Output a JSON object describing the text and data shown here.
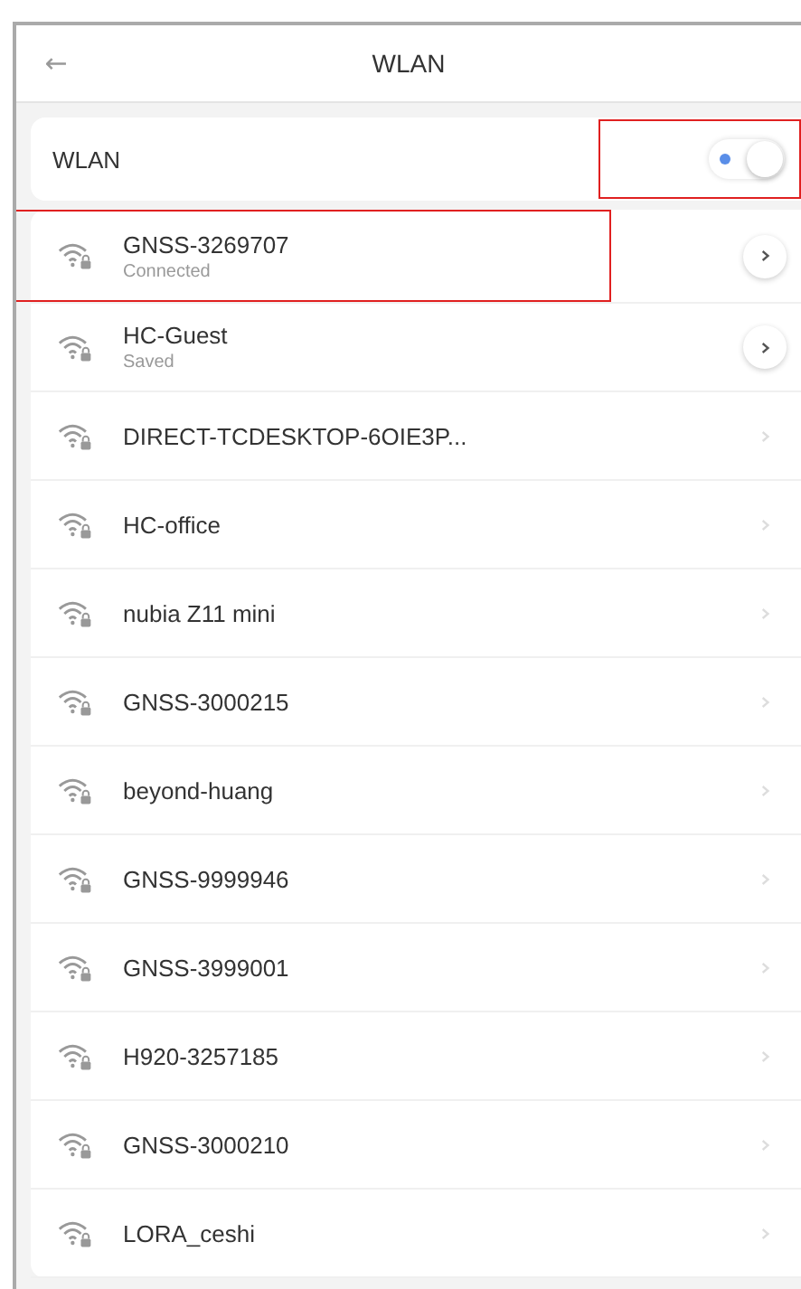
{
  "header": {
    "back": "←",
    "title": "WLAN"
  },
  "wlan_switch": {
    "label": "WLAN",
    "on": true,
    "highlighted": true
  },
  "networks": [
    {
      "name": "GNSS-3269707",
      "status": "Connected",
      "saved": true,
      "highlighted": true
    },
    {
      "name": "HC-Guest",
      "status": "Saved",
      "saved": true,
      "highlighted": false
    },
    {
      "name": "DIRECT-TCDESKTOP-6OIE3P...",
      "saved": false,
      "highlighted": false
    },
    {
      "name": "HC-office",
      "saved": false,
      "highlighted": false
    },
    {
      "name": "nubia Z11 mini",
      "saved": false,
      "highlighted": false
    },
    {
      "name": "GNSS-3000215",
      "saved": false,
      "highlighted": false
    },
    {
      "name": "beyond-huang",
      "saved": false,
      "highlighted": false
    },
    {
      "name": "GNSS-9999946",
      "saved": false,
      "highlighted": false
    },
    {
      "name": "GNSS-3999001",
      "saved": false,
      "highlighted": false
    },
    {
      "name": "H920-3257185",
      "saved": false,
      "highlighted": false
    },
    {
      "name": "GNSS-3000210",
      "saved": false,
      "highlighted": false
    },
    {
      "name": "LORA_ceshi",
      "saved": false,
      "highlighted": false
    }
  ]
}
